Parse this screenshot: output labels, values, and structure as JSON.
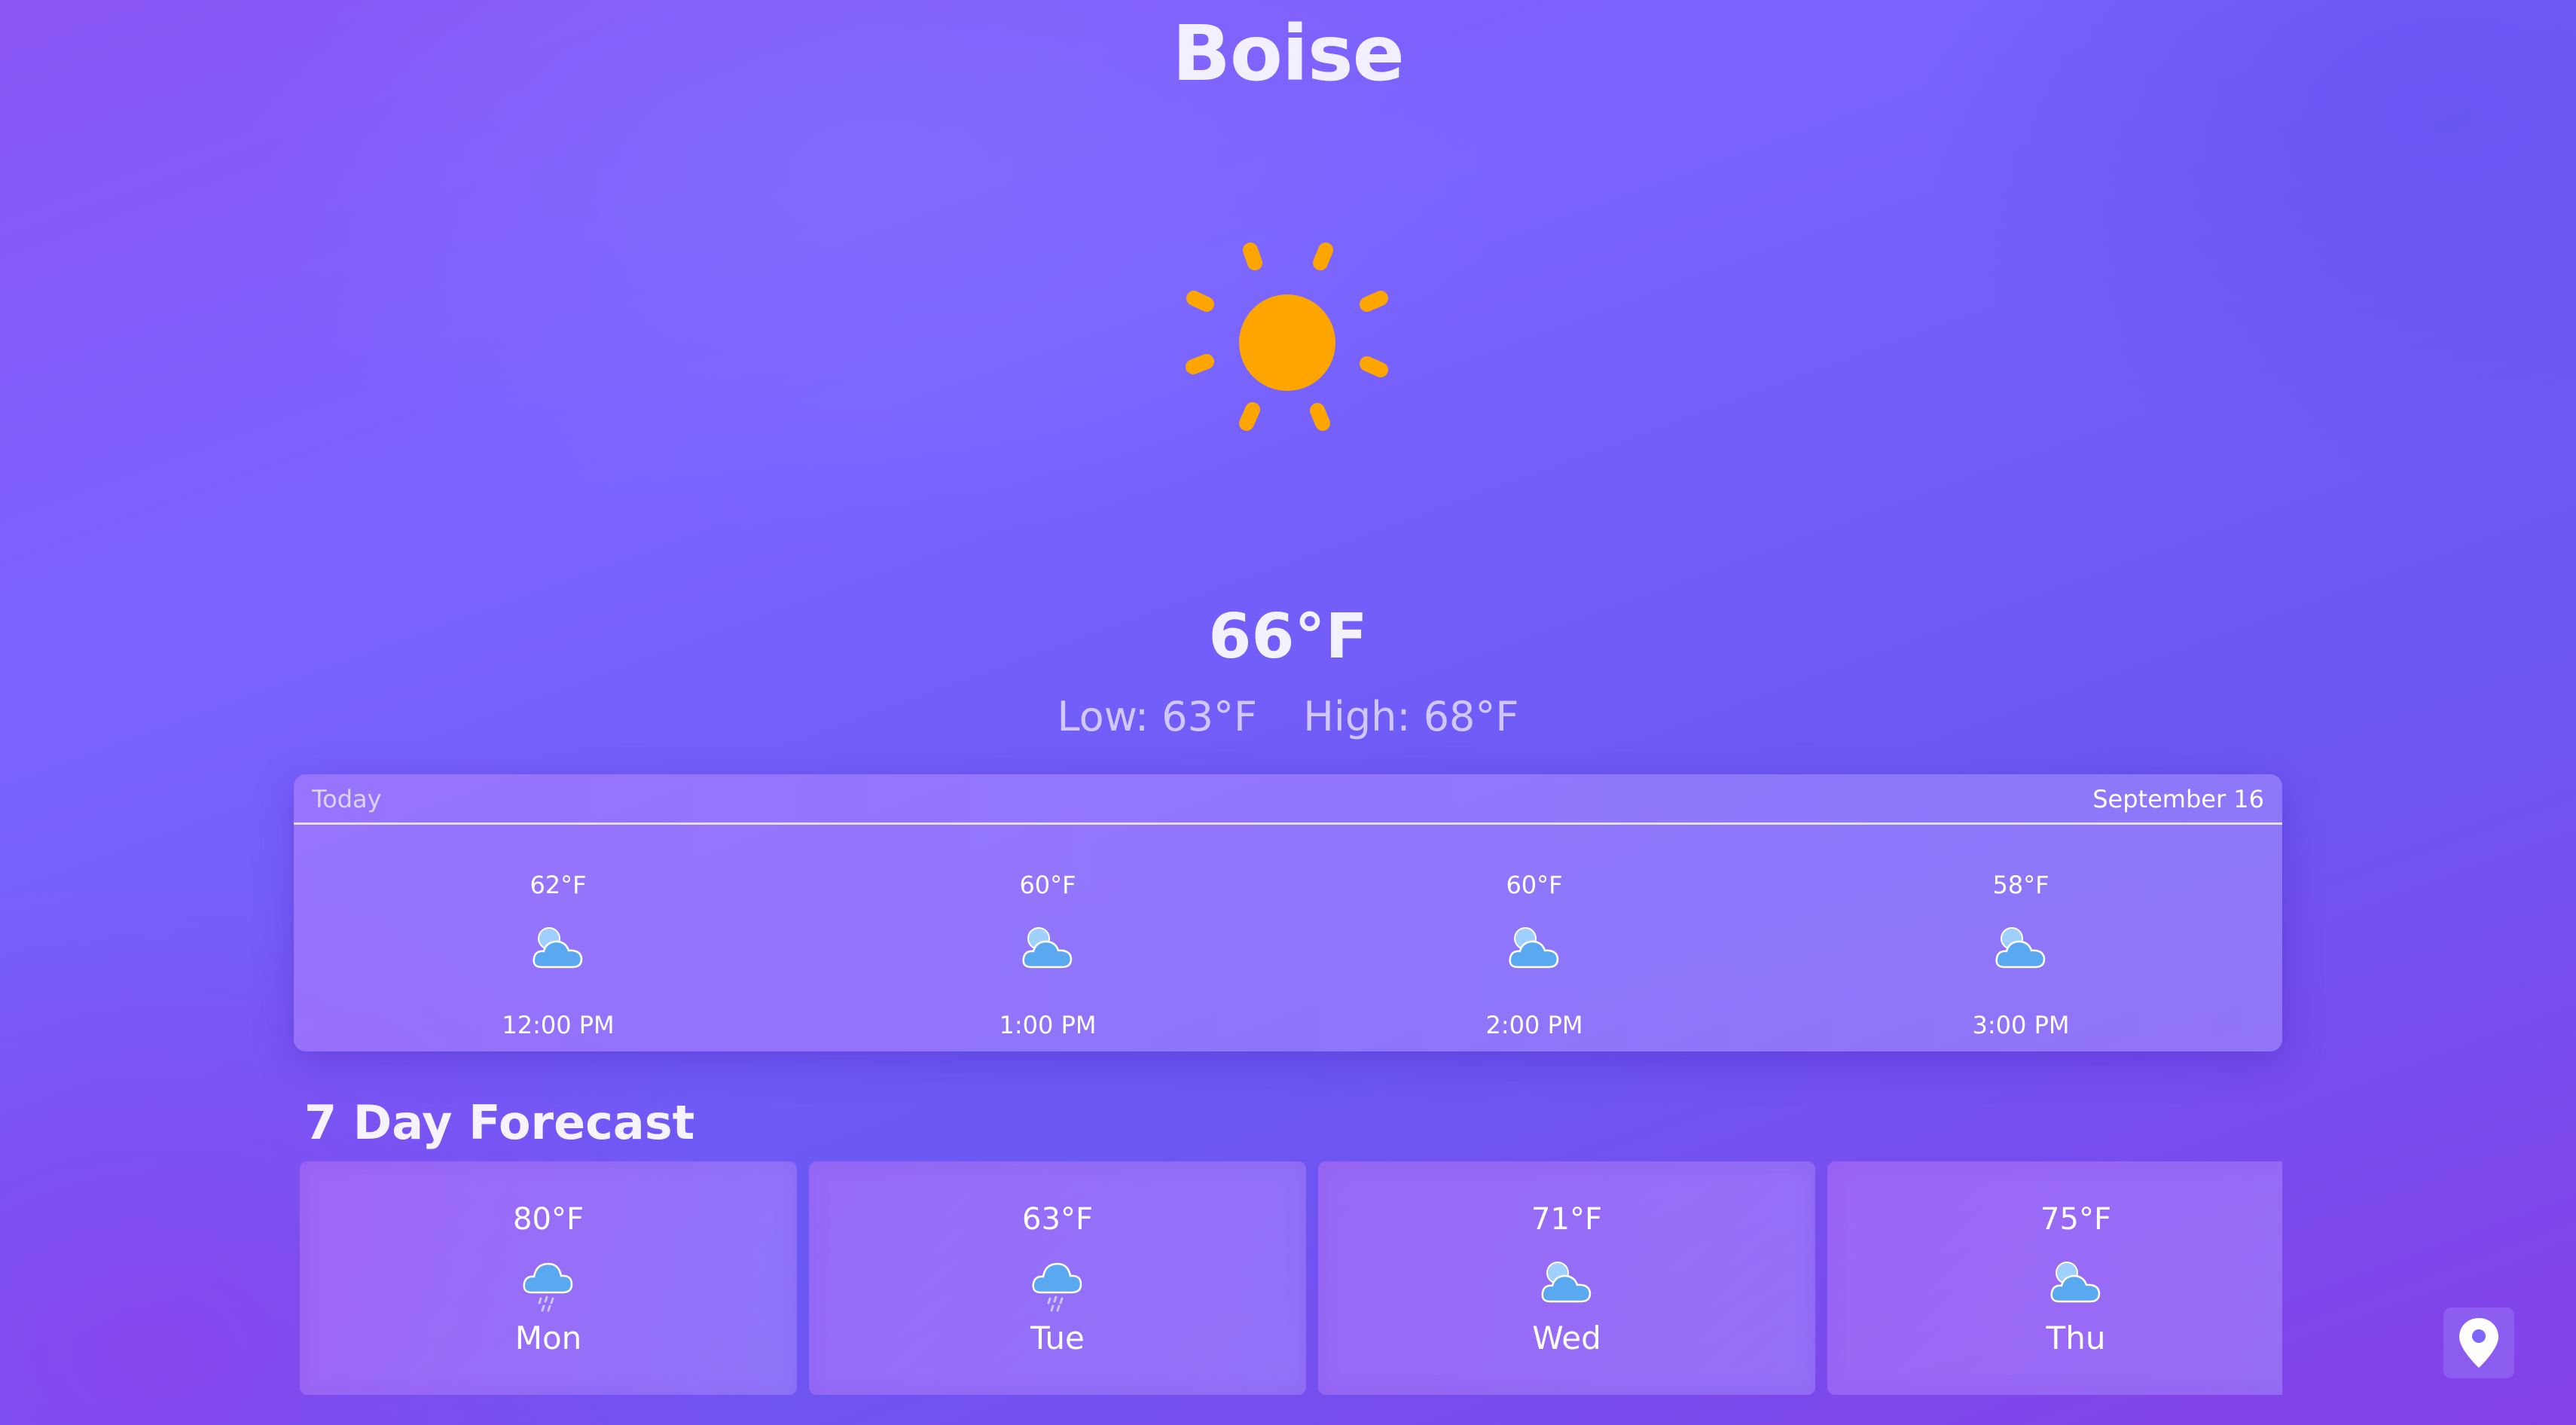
{
  "city": "Boise",
  "current": {
    "icon": "sun-icon",
    "temp": "66°F",
    "low": "Low: 63°F",
    "high": "High: 68°F"
  },
  "hourly": {
    "label": "Today",
    "date": "September 16",
    "items": [
      {
        "temp": "62°F",
        "icon": "partly-cloudy-icon",
        "time": "12:00 PM"
      },
      {
        "temp": "60°F",
        "icon": "partly-cloudy-icon",
        "time": "1:00 PM"
      },
      {
        "temp": "60°F",
        "icon": "partly-cloudy-icon",
        "time": "2:00 PM"
      },
      {
        "temp": "58°F",
        "icon": "partly-cloudy-icon",
        "time": "3:00 PM"
      }
    ]
  },
  "forecast": {
    "title": "7 Day Forecast",
    "days": [
      {
        "temp": "80°F",
        "icon": "rain-cloud-icon",
        "day": "Mon"
      },
      {
        "temp": "63°F",
        "icon": "rain-cloud-icon",
        "day": "Tue"
      },
      {
        "temp": "71°F",
        "icon": "partly-cloudy-icon",
        "day": "Wed"
      },
      {
        "temp": "75°F",
        "icon": "partly-cloudy-icon",
        "day": "Thu"
      }
    ]
  },
  "location_button": {
    "icon": "location-pin-icon"
  },
  "colors": {
    "sun": "#ffa500",
    "cloud": "#5aa9f0",
    "background_start": "#8a55f3",
    "background_end": "#6b58f3"
  }
}
